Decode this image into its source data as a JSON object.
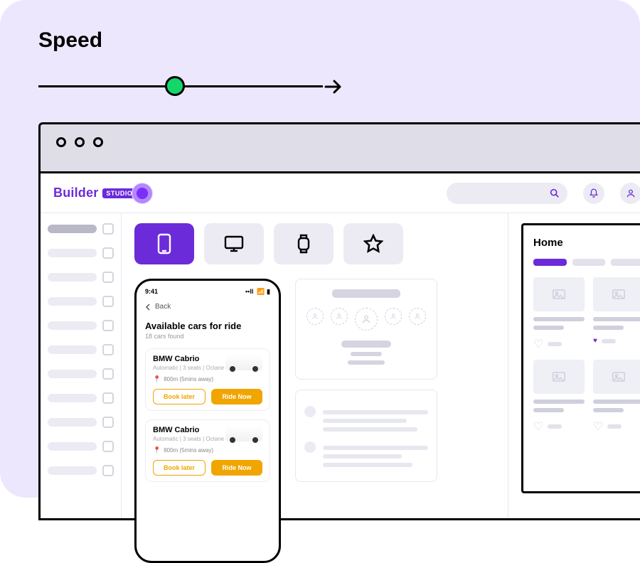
{
  "header": {
    "title": "Speed"
  },
  "brand": {
    "name": "Builder",
    "chip": "STUDIO"
  },
  "icons": {
    "search": "search-icon",
    "bell": "bell-icon",
    "user": "user-icon",
    "record": "record-icon",
    "phone": "phone-icon",
    "desktop": "desktop-icon",
    "watch": "watch-icon",
    "star": "star-icon"
  },
  "device_tabs": [
    {
      "id": "phone",
      "active": true
    },
    {
      "id": "desktop",
      "active": false
    },
    {
      "id": "watch",
      "active": false
    },
    {
      "id": "star",
      "active": false
    }
  ],
  "phone_mock": {
    "time": "9:41",
    "back_label": "Back",
    "title": "Available cars for ride",
    "subtitle": "18 cars found",
    "cards": [
      {
        "name": "BMW Cabrio",
        "meta": "Automatic  |  3 seats  |  Octane",
        "distance": "800m (5mins away)",
        "later": "Book later",
        "now": "Ride Now"
      },
      {
        "name": "BMW Cabrio",
        "meta": "Automatic  |  3 seats  |  Octane",
        "distance": "800m (5mins away)",
        "later": "Book later",
        "now": "Ride Now"
      }
    ]
  },
  "preview": {
    "title": "Home"
  }
}
